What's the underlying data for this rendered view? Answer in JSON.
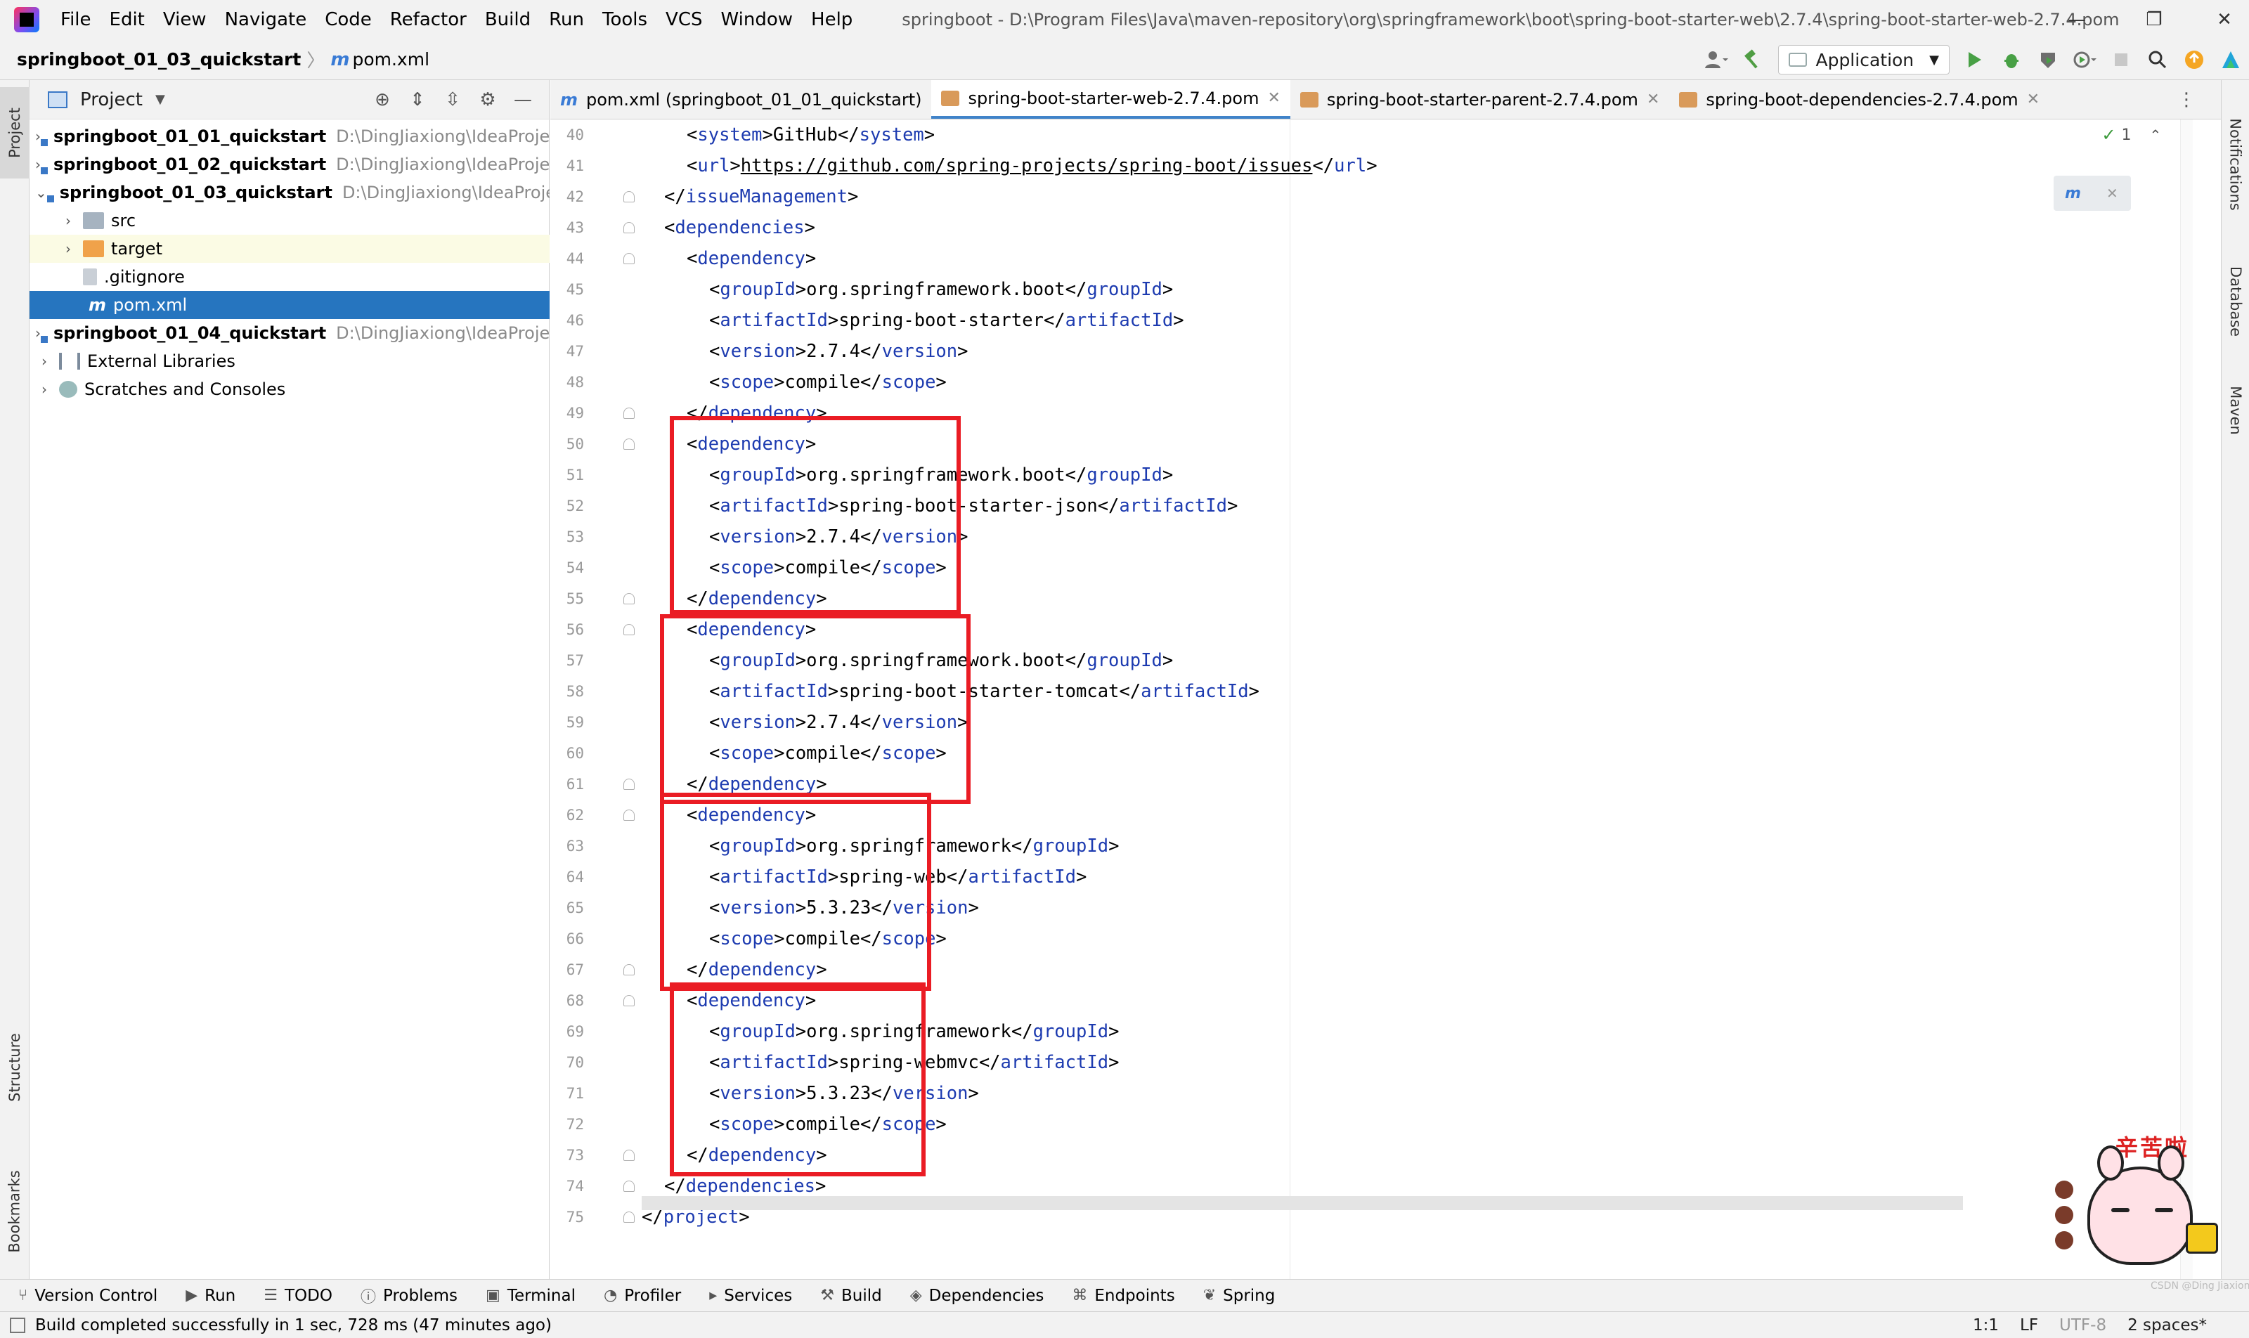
{
  "menubar": {
    "items": [
      "File",
      "Edit",
      "View",
      "Navigate",
      "Code",
      "Refactor",
      "Build",
      "Run",
      "Tools",
      "VCS",
      "Window",
      "Help"
    ],
    "window_title": "springboot - D:\\Program Files\\Java\\maven-repository\\org\\springframework\\boot\\spring-boot-starter-web\\2.7.4\\spring-boot-starter-web-2.7.4.pom",
    "minimize": "—",
    "restore": "❐",
    "close": "✕"
  },
  "navbar": {
    "project": "springboot_01_03_quickstart",
    "separator": "〉",
    "file_icon": "m",
    "file": "pom.xml",
    "run_config": "Application"
  },
  "left_strip": {
    "project": "Project",
    "structure": "Structure",
    "bookmarks": "Bookmarks"
  },
  "project_panel": {
    "title": "Project",
    "tree": [
      {
        "name": "springboot_01_01_quickstart",
        "path": "D:\\DingJiaxiong\\IdeaProje",
        "arrow": "›"
      },
      {
        "name": "springboot_01_02_quickstart",
        "path": "D:\\DingJiaxiong\\IdeaProje",
        "arrow": "›"
      },
      {
        "name": "springboot_01_03_quickstart",
        "path": "D:\\DingJiaxiong\\IdeaProje",
        "arrow": "⌄"
      },
      {
        "name": "src",
        "arrow": "›"
      },
      {
        "name": "target",
        "arrow": "›"
      },
      {
        "name": ".gitignore"
      },
      {
        "name": "pom.xml",
        "icon": "m"
      },
      {
        "name": "springboot_01_04_quickstart",
        "path": "D:\\DingJiaxiong\\IdeaProje",
        "arrow": "›"
      },
      {
        "name": "External Libraries",
        "arrow": "›"
      },
      {
        "name": "Scratches and Consoles",
        "arrow": "›"
      }
    ]
  },
  "tabs": [
    {
      "label": "pom.xml (springboot_01_01_quickstart)",
      "icon": "m"
    },
    {
      "label": "spring-boot-starter-web-2.7.4.pom",
      "close": "✕"
    },
    {
      "label": "spring-boot-starter-parent-2.7.4.pom",
      "close": "✕"
    },
    {
      "label": "spring-boot-dependencies-2.7.4.pom",
      "close": "✕"
    }
  ],
  "editor": {
    "inspection_count": "1",
    "inspection_ok": "✓",
    "maven_reload_icon": "m",
    "line_numbers": [
      "40",
      "41",
      "42",
      "43",
      "44",
      "45",
      "46",
      "47",
      "48",
      "49",
      "50",
      "51",
      "52",
      "53",
      "54",
      "55",
      "56",
      "57",
      "58",
      "59",
      "60",
      "61",
      "62",
      "63",
      "64",
      "65",
      "66",
      "67",
      "68",
      "69",
      "70",
      "71",
      "72",
      "73",
      "74",
      "75"
    ],
    "lines": [
      {
        "indent": 2,
        "parts": [
          [
            "t",
            "<"
          ],
          [
            "g",
            "system"
          ],
          [
            "t",
            ">GitHub</"
          ],
          [
            "g",
            "system"
          ],
          [
            "t",
            ">"
          ]
        ]
      },
      {
        "indent": 2,
        "parts": [
          [
            "t",
            "<"
          ],
          [
            "g",
            "url"
          ],
          [
            "t",
            ">"
          ],
          [
            "u",
            "https://github.com/spring-projects/spring-boot/issues"
          ],
          [
            "t",
            "</"
          ],
          [
            "g",
            "url"
          ],
          [
            "t",
            ">"
          ]
        ]
      },
      {
        "indent": 1,
        "parts": [
          [
            "t",
            "</"
          ],
          [
            "g",
            "issueManagement"
          ],
          [
            "t",
            ">"
          ]
        ]
      },
      {
        "indent": 1,
        "parts": [
          [
            "t",
            "<"
          ],
          [
            "g",
            "dependencies"
          ],
          [
            "t",
            ">"
          ]
        ]
      },
      {
        "indent": 2,
        "parts": [
          [
            "t",
            "<"
          ],
          [
            "g",
            "dependency"
          ],
          [
            "t",
            ">"
          ]
        ]
      },
      {
        "indent": 3,
        "parts": [
          [
            "t",
            "<"
          ],
          [
            "g",
            "groupId"
          ],
          [
            "t",
            ">org.springframework.boot</"
          ],
          [
            "g",
            "groupId"
          ],
          [
            "t",
            ">"
          ]
        ]
      },
      {
        "indent": 3,
        "parts": [
          [
            "t",
            "<"
          ],
          [
            "g",
            "artifactId"
          ],
          [
            "t",
            ">spring-boot-starter</"
          ],
          [
            "g",
            "artifactId"
          ],
          [
            "t",
            ">"
          ]
        ]
      },
      {
        "indent": 3,
        "parts": [
          [
            "t",
            "<"
          ],
          [
            "g",
            "version"
          ],
          [
            "t",
            ">2.7.4</"
          ],
          [
            "g",
            "version"
          ],
          [
            "t",
            ">"
          ]
        ]
      },
      {
        "indent": 3,
        "parts": [
          [
            "t",
            "<"
          ],
          [
            "g",
            "scope"
          ],
          [
            "t",
            ">compile</"
          ],
          [
            "g",
            "scope"
          ],
          [
            "t",
            ">"
          ]
        ]
      },
      {
        "indent": 2,
        "parts": [
          [
            "t",
            "</"
          ],
          [
            "g",
            "dependency"
          ],
          [
            "t",
            ">"
          ]
        ]
      },
      {
        "indent": 2,
        "parts": [
          [
            "t",
            "<"
          ],
          [
            "g",
            "dependency"
          ],
          [
            "t",
            ">"
          ]
        ]
      },
      {
        "indent": 3,
        "parts": [
          [
            "t",
            "<"
          ],
          [
            "g",
            "groupId"
          ],
          [
            "t",
            ">org.springframework.boot</"
          ],
          [
            "g",
            "groupId"
          ],
          [
            "t",
            ">"
          ]
        ]
      },
      {
        "indent": 3,
        "parts": [
          [
            "t",
            "<"
          ],
          [
            "g",
            "artifactId"
          ],
          [
            "t",
            ">spring-boot-starter-json</"
          ],
          [
            "g",
            "artifactId"
          ],
          [
            "t",
            ">"
          ]
        ]
      },
      {
        "indent": 3,
        "parts": [
          [
            "t",
            "<"
          ],
          [
            "g",
            "version"
          ],
          [
            "t",
            ">2.7.4</"
          ],
          [
            "g",
            "version"
          ],
          [
            "t",
            ">"
          ]
        ]
      },
      {
        "indent": 3,
        "parts": [
          [
            "t",
            "<"
          ],
          [
            "g",
            "scope"
          ],
          [
            "t",
            ">compile</"
          ],
          [
            "g",
            "scope"
          ],
          [
            "t",
            ">"
          ]
        ]
      },
      {
        "indent": 2,
        "parts": [
          [
            "t",
            "</"
          ],
          [
            "g",
            "dependency"
          ],
          [
            "t",
            ">"
          ]
        ]
      },
      {
        "indent": 2,
        "parts": [
          [
            "t",
            "<"
          ],
          [
            "g",
            "dependency"
          ],
          [
            "t",
            ">"
          ]
        ]
      },
      {
        "indent": 3,
        "parts": [
          [
            "t",
            "<"
          ],
          [
            "g",
            "groupId"
          ],
          [
            "t",
            ">org.springframework.boot</"
          ],
          [
            "g",
            "groupId"
          ],
          [
            "t",
            ">"
          ]
        ]
      },
      {
        "indent": 3,
        "parts": [
          [
            "t",
            "<"
          ],
          [
            "g",
            "artifactId"
          ],
          [
            "t",
            ">spring-boot-starter-tomcat</"
          ],
          [
            "g",
            "artifactId"
          ],
          [
            "t",
            ">"
          ]
        ]
      },
      {
        "indent": 3,
        "parts": [
          [
            "t",
            "<"
          ],
          [
            "g",
            "version"
          ],
          [
            "t",
            ">2.7.4</"
          ],
          [
            "g",
            "version"
          ],
          [
            "t",
            ">"
          ]
        ]
      },
      {
        "indent": 3,
        "parts": [
          [
            "t",
            "<"
          ],
          [
            "g",
            "scope"
          ],
          [
            "t",
            ">compile</"
          ],
          [
            "g",
            "scope"
          ],
          [
            "t",
            ">"
          ]
        ]
      },
      {
        "indent": 2,
        "parts": [
          [
            "t",
            "</"
          ],
          [
            "g",
            "dependency"
          ],
          [
            "t",
            ">"
          ]
        ]
      },
      {
        "indent": 2,
        "parts": [
          [
            "t",
            "<"
          ],
          [
            "g",
            "dependency"
          ],
          [
            "t",
            ">"
          ]
        ]
      },
      {
        "indent": 3,
        "parts": [
          [
            "t",
            "<"
          ],
          [
            "g",
            "groupId"
          ],
          [
            "t",
            ">org.springframework</"
          ],
          [
            "g",
            "groupId"
          ],
          [
            "t",
            ">"
          ]
        ]
      },
      {
        "indent": 3,
        "parts": [
          [
            "t",
            "<"
          ],
          [
            "g",
            "artifactId"
          ],
          [
            "t",
            ">spring-web</"
          ],
          [
            "g",
            "artifactId"
          ],
          [
            "t",
            ">"
          ]
        ]
      },
      {
        "indent": 3,
        "parts": [
          [
            "t",
            "<"
          ],
          [
            "g",
            "version"
          ],
          [
            "t",
            ">5.3.23</"
          ],
          [
            "g",
            "version"
          ],
          [
            "t",
            ">"
          ]
        ]
      },
      {
        "indent": 3,
        "parts": [
          [
            "t",
            "<"
          ],
          [
            "g",
            "scope"
          ],
          [
            "t",
            ">compile</"
          ],
          [
            "g",
            "scope"
          ],
          [
            "t",
            ">"
          ]
        ]
      },
      {
        "indent": 2,
        "parts": [
          [
            "t",
            "</"
          ],
          [
            "g",
            "dependency"
          ],
          [
            "t",
            ">"
          ]
        ]
      },
      {
        "indent": 2,
        "parts": [
          [
            "t",
            "<"
          ],
          [
            "g",
            "dependency"
          ],
          [
            "t",
            ">"
          ]
        ]
      },
      {
        "indent": 3,
        "parts": [
          [
            "t",
            "<"
          ],
          [
            "g",
            "groupId"
          ],
          [
            "t",
            ">org.springframework</"
          ],
          [
            "g",
            "groupId"
          ],
          [
            "t",
            ">"
          ]
        ]
      },
      {
        "indent": 3,
        "parts": [
          [
            "t",
            "<"
          ],
          [
            "g",
            "artifactId"
          ],
          [
            "t",
            ">spring-webmvc</"
          ],
          [
            "g",
            "artifactId"
          ],
          [
            "t",
            ">"
          ]
        ]
      },
      {
        "indent": 3,
        "parts": [
          [
            "t",
            "<"
          ],
          [
            "g",
            "version"
          ],
          [
            "t",
            ">5.3.23</"
          ],
          [
            "g",
            "version"
          ],
          [
            "t",
            ">"
          ]
        ]
      },
      {
        "indent": 3,
        "parts": [
          [
            "t",
            "<"
          ],
          [
            "g",
            "scope"
          ],
          [
            "t",
            ">compile</"
          ],
          [
            "g",
            "scope"
          ],
          [
            "t",
            ">"
          ]
        ]
      },
      {
        "indent": 2,
        "parts": [
          [
            "t",
            "</"
          ],
          [
            "g",
            "dependency"
          ],
          [
            "t",
            ">"
          ]
        ]
      },
      {
        "indent": 1,
        "parts": [
          [
            "t",
            "</"
          ],
          [
            "g",
            "dependencies"
          ],
          [
            "t",
            ">"
          ]
        ]
      },
      {
        "indent": 0,
        "parts": [
          [
            "t",
            "</"
          ],
          [
            "g",
            "project"
          ],
          [
            "t",
            ">"
          ]
        ]
      }
    ]
  },
  "right_strip": {
    "notifications": "Notifications",
    "database": "Database",
    "maven": "Maven"
  },
  "bottom_bar": {
    "tabs": [
      {
        "label": "Version Control",
        "icon": "branch-icon",
        "glyph": "⑂"
      },
      {
        "label": "Run",
        "icon": "run-icon",
        "glyph": "▶"
      },
      {
        "label": "TODO",
        "icon": "todo-icon",
        "glyph": "☰"
      },
      {
        "label": "Problems",
        "icon": "problems-icon",
        "glyph": "ⓘ"
      },
      {
        "label": "Terminal",
        "icon": "terminal-icon",
        "glyph": "▣"
      },
      {
        "label": "Profiler",
        "icon": "profiler-icon",
        "glyph": "◔"
      },
      {
        "label": "Services",
        "icon": "services-icon",
        "glyph": "▸"
      },
      {
        "label": "Build",
        "icon": "hammer-icon",
        "glyph": "⚒"
      },
      {
        "label": "Dependencies",
        "icon": "layers-icon",
        "glyph": "◈"
      },
      {
        "label": "Endpoints",
        "icon": "endpoints-icon",
        "glyph": "⌘"
      },
      {
        "label": "Spring",
        "icon": "spring-icon",
        "glyph": "❦"
      }
    ]
  },
  "status": {
    "message": "Build completed successfully in 1 sec, 728 ms (47 minutes ago)",
    "position": "1:1",
    "line_sep": "LF",
    "encoding": "UTF-8",
    "indent": "2 spaces*"
  },
  "sticker": {
    "text": "辛苦啦",
    "watermark": "CSDN @Ding Jiaxiong"
  },
  "colors": {
    "tag": "#1d3bb0",
    "highlight_box": "#ea1c24",
    "selection": "#2675bf",
    "accent": "#4083c9"
  }
}
